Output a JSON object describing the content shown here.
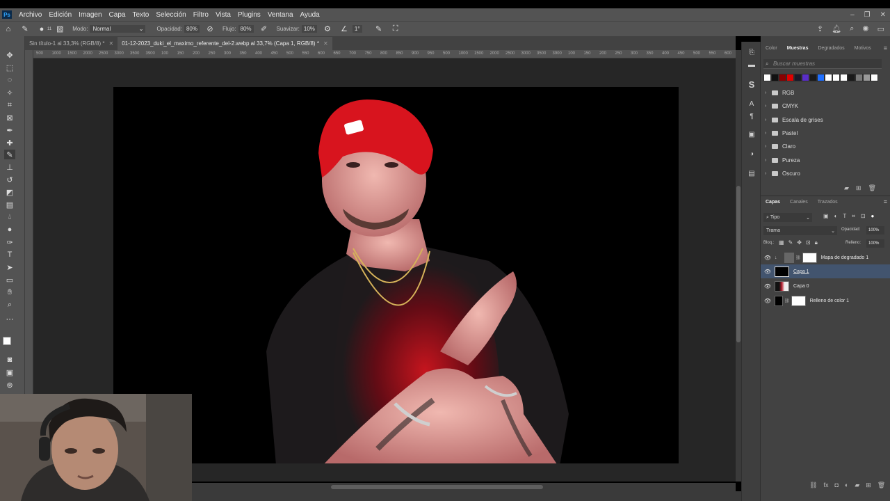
{
  "app": {
    "logo": "Ps"
  },
  "menu": [
    "Archivo",
    "Edición",
    "Imagen",
    "Capa",
    "Texto",
    "Selección",
    "Filtro",
    "Vista",
    "Plugins",
    "Ventana",
    "Ayuda"
  ],
  "options": {
    "modo_label": "Modo:",
    "modo_value": "Normal",
    "opacidad_label": "Opacidad:",
    "opacidad_value": "80%",
    "flujo_label": "Flujo:",
    "flujo_value": "80%",
    "suavizar_label": "Suavizar:",
    "suavizar_value": "10%",
    "angle_value": "1°",
    "brush_size": "11"
  },
  "tabs": [
    {
      "label": "Sin título-1 al 33,3% (RGB/8) *"
    },
    {
      "label": "01-12-2023_duki_el_maximo_referente_del-2.webp al 33,7% (Capa 1, RGB/8) *"
    }
  ],
  "ruler_ticks": [
    "500",
    "1000",
    "1500",
    "2000",
    "2500",
    "3000",
    "3500",
    "3900",
    "100",
    "150",
    "200",
    "250",
    "300",
    "350",
    "400",
    "450",
    "500",
    "550",
    "600",
    "650",
    "700",
    "750",
    "800",
    "850",
    "900",
    "950"
  ],
  "swatches_panel": {
    "tabs": [
      "Color",
      "Muestras",
      "Degradados",
      "Motivos"
    ],
    "active_tab": "Muestras",
    "search_placeholder": "Buscar muestras",
    "swatch_colors": [
      "#ffffff",
      "#111111",
      "#8a0000",
      "#e00000",
      "#1a1a2a",
      "#5a2ec8",
      "#1a1a1a",
      "#1f6fff",
      "#ffffff",
      "#ffffff",
      "#ffffff",
      "#1a1a1a",
      "#7a7a7a",
      "#9a9a9a",
      "#ffffff"
    ],
    "groups": [
      "RGB",
      "CMYK",
      "Escala de grises",
      "Pastel",
      "Claro",
      "Pureza",
      "Oscuro"
    ]
  },
  "layers_panel": {
    "tabs": [
      "Capas",
      "Canales",
      "Trazados"
    ],
    "active_tab": "Capas",
    "filter_label": "Tipo",
    "blend_mode": "Trama",
    "opacity_label": "Opacidad:",
    "opacity_value": "100%",
    "lock_label": "Bloq.:",
    "fill_label": "Relleno:",
    "fill_value": "100%",
    "layers": [
      {
        "name": "Mapa de degradado 1",
        "selected": false
      },
      {
        "name": "Capa 1",
        "selected": true
      },
      {
        "name": "Capa 0",
        "selected": false
      },
      {
        "name": "Relleno de color 1",
        "selected": false
      }
    ]
  },
  "colors": {
    "accent": "#31a8ff",
    "selection": "#42546e",
    "cap_red": "#d8141e"
  }
}
